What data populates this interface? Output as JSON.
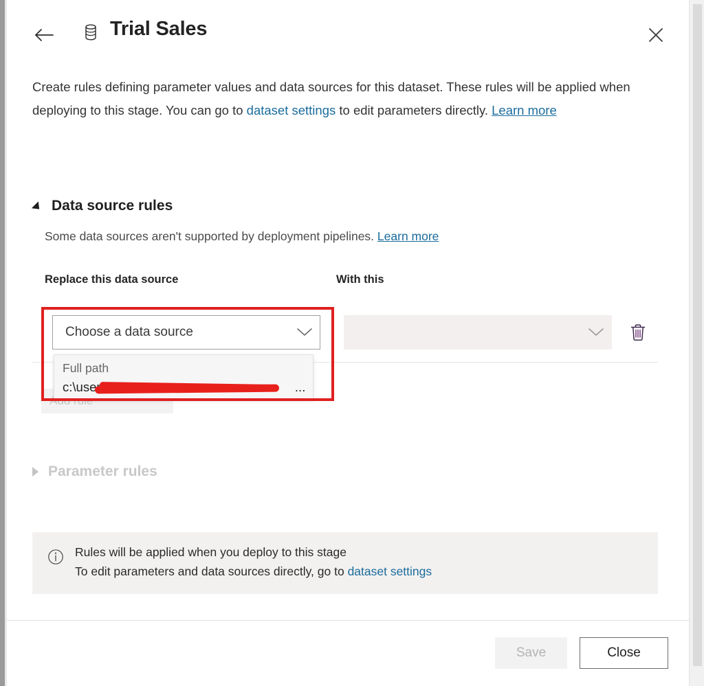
{
  "window": {
    "title": "Trial Sales",
    "dataset_icon": "database-icon",
    "back_icon": "back-arrow-icon",
    "close_icon": "close-icon"
  },
  "description": {
    "part1": "Create rules defining parameter values and data sources for this dataset. These rules will be applied when deploying to this stage. You can go to ",
    "link_dataset_settings": "dataset settings",
    "part2": " to edit parameters directly. ",
    "link_learn_more": "Learn more"
  },
  "data_source_section": {
    "title": "Data source rules",
    "expanded": true,
    "toggle_icon": "triangle-down-icon",
    "subtitle": "Some data sources aren't supported by deployment pipelines. ",
    "subtitle_link": "Learn more",
    "columns": {
      "left": "Replace this data source",
      "right": "With this"
    },
    "rule": {
      "source_value": "Choose a data source",
      "source_placeholder": "Choose a data source",
      "target_value": "",
      "target_placeholder": "",
      "target_disabled": true,
      "chevron_icon": "chevron-down-icon",
      "delete_icon": "trash-icon"
    },
    "add_rule_label": "Add rule",
    "tooltip": {
      "label": "Full path",
      "path_prefix": "c:\\users\\",
      "path_suffix": "...",
      "redacted": true
    }
  },
  "parameter_section": {
    "title": "Parameter rules",
    "expanded": false,
    "toggle_icon": "triangle-right-icon",
    "disabled": true
  },
  "info_banner": {
    "icon": "info-icon",
    "line1": "Rules will be applied when you deploy to this stage",
    "line2_prefix": "To edit parameters and data sources directly, go to ",
    "line2_link": "dataset settings"
  },
  "footer": {
    "save_label": "Save",
    "save_disabled": true,
    "close_label": "Close"
  },
  "annotation": {
    "color": "#e02020",
    "shape": "rectangle"
  },
  "colors": {
    "link": "#1a6c9c",
    "text": "#242424",
    "disabled_text": "#c8c8c8",
    "banner_bg": "#f3f1f0",
    "annotation_red": "#e02020",
    "redaction_red": "#e8201b"
  }
}
